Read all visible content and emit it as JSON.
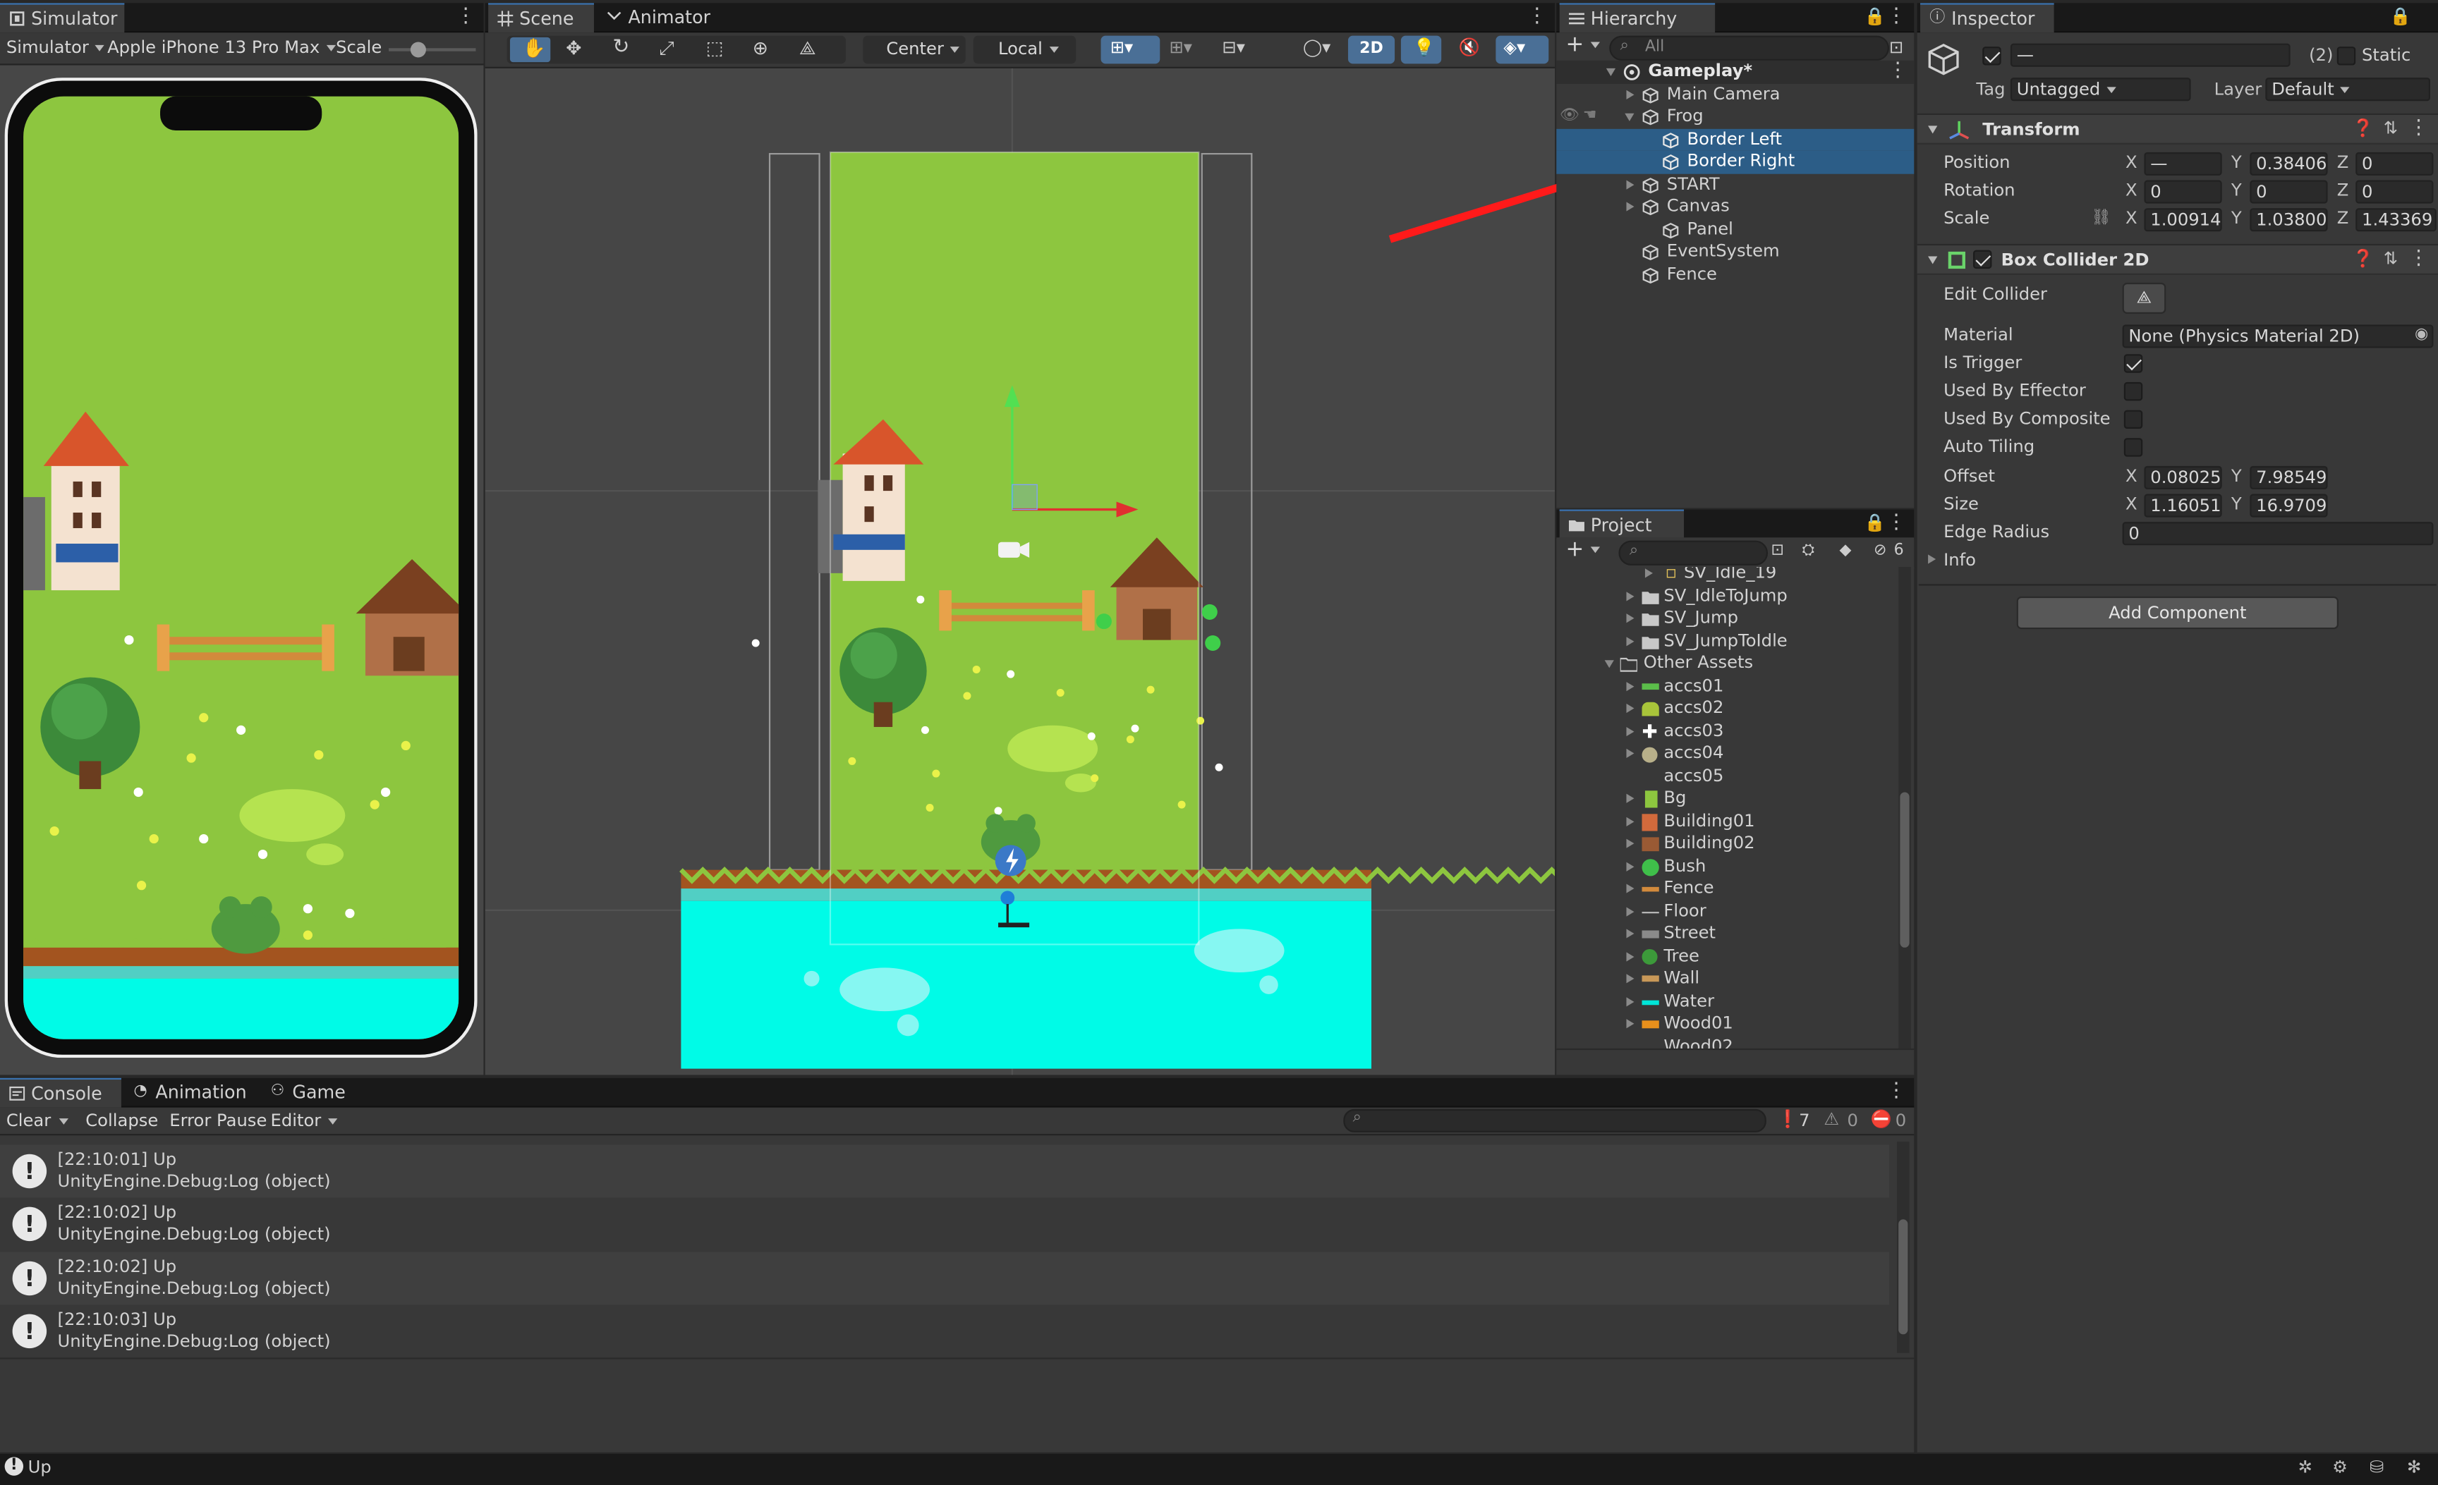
{
  "simulator": {
    "tab": "Simulator",
    "mode_dropdown": "Simulator",
    "device_dropdown": "Apple iPhone 13 Pro Max",
    "scale_label": "Scale"
  },
  "scene": {
    "tabs": [
      "Scene",
      "Animator"
    ],
    "pivot_dropdown": "Center",
    "space_dropdown": "Local",
    "toggle_2d": "2D"
  },
  "hierarchy": {
    "tab": "Hierarchy",
    "search_placeholder": "All",
    "scene_name": "Gameplay*",
    "items": [
      {
        "label": "Main Camera"
      },
      {
        "label": "Frog"
      },
      {
        "label": "Border Left"
      },
      {
        "label": "Border Right"
      },
      {
        "label": "START"
      },
      {
        "label": "Canvas"
      },
      {
        "label": "Panel"
      },
      {
        "label": "EventSystem"
      },
      {
        "label": "Fence"
      }
    ]
  },
  "project": {
    "tab": "Project",
    "hidden_count": "6",
    "items": [
      {
        "label": "SV_Idle_19"
      },
      {
        "label": "SV_IdleToJump"
      },
      {
        "label": "SV_Jump"
      },
      {
        "label": "SV_JumpToIdle"
      },
      {
        "label": "Other Assets"
      },
      {
        "label": "accs01"
      },
      {
        "label": "accs02"
      },
      {
        "label": "accs03"
      },
      {
        "label": "accs04"
      },
      {
        "label": "accs05"
      },
      {
        "label": "Bg"
      },
      {
        "label": "Building01"
      },
      {
        "label": "Building02"
      },
      {
        "label": "Bush"
      },
      {
        "label": "Fence"
      },
      {
        "label": "Floor"
      },
      {
        "label": "Street"
      },
      {
        "label": "Tree"
      },
      {
        "label": "Wall"
      },
      {
        "label": "Water"
      },
      {
        "label": "Wood01"
      },
      {
        "label": "Wood02"
      }
    ]
  },
  "inspector": {
    "tab": "Inspector",
    "name_value": "—",
    "count": "(2)",
    "static_label": "Static",
    "tag_label": "Tag",
    "tag_value": "Untagged",
    "layer_label": "Layer",
    "layer_value": "Default",
    "transform": {
      "title": "Transform",
      "position_label": "Position",
      "rotation_label": "Rotation",
      "scale_label": "Scale",
      "position": {
        "x": "—",
        "y": "0.38406",
        "z": "0"
      },
      "rotation": {
        "x": "0",
        "y": "0",
        "z": "0"
      },
      "scale": {
        "x": "1.00914",
        "y": "1.03800",
        "z": "1.43369"
      }
    },
    "box_collider": {
      "title": "Box Collider 2D",
      "edit_collider_label": "Edit Collider",
      "material_label": "Material",
      "material_value": "None (Physics Material 2D)",
      "is_trigger_label": "Is Trigger",
      "is_trigger": true,
      "used_by_effector_label": "Used By Effector",
      "used_by_composite_label": "Used By Composite",
      "auto_tiling_label": "Auto Tiling",
      "offset_label": "Offset",
      "offset": {
        "x": "0.08025",
        "y": "7.98549"
      },
      "size_label": "Size",
      "size": {
        "x": "1.160513",
        "y": "16.97099"
      },
      "edge_radius_label": "Edge Radius",
      "edge_radius": "0",
      "info_label": "Info"
    },
    "add_component_label": "Add Component"
  },
  "console": {
    "tabs": [
      "Console",
      "Animation",
      "Game"
    ],
    "clear_label": "Clear",
    "collapse_label": "Collapse",
    "error_pause_label": "Error Pause",
    "editor_label": "Editor",
    "log_count": "7",
    "warning_count": "0",
    "error_count": "0",
    "entries": [
      {
        "line1": "[22:10:01] Up",
        "line2": "UnityEngine.Debug:Log (object)"
      },
      {
        "line1": "[22:10:02] Up",
        "line2": "UnityEngine.Debug:Log (object)"
      },
      {
        "line1": "[22:10:02] Up",
        "line2": "UnityEngine.Debug:Log (object)"
      },
      {
        "line1": "[22:10:03] Up",
        "line2": "UnityEngine.Debug:Log (object)"
      }
    ]
  },
  "status_bar": {
    "message": "Up"
  },
  "colors": {
    "grass": "#8dc63f",
    "water": "#00fbe7",
    "selection": "#2c5d87",
    "annotation_arrow": "#ff1a1a"
  }
}
